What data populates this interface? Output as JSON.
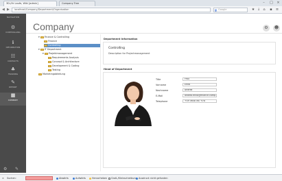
{
  "browser": {
    "tab1_title": "3D-/Hr Laufe, Wiki [admin]",
    "tab2_title": "Company Tree",
    "url": "localhost/Company/Department/Organisation",
    "search_placeholder": "Google"
  },
  "leftnav": {
    "items": [
      {
        "label": "NAVIGATION",
        "icon": "compass-icon"
      },
      {
        "label": "CONTROLLING",
        "icon": "gear-icon"
      },
      {
        "label": "INFORMATION",
        "icon": "info-icon"
      },
      {
        "label": "CONTACTS",
        "icon": "contacts-icon"
      },
      {
        "label": "TRAINING",
        "icon": "training-icon"
      },
      {
        "label": "REPORT",
        "icon": "report-icon"
      },
      {
        "label": "COMPANY",
        "icon": "company-icon"
      }
    ]
  },
  "app": {
    "title": "Company"
  },
  "tree": {
    "items": [
      {
        "label": "Finance & Controlling"
      },
      {
        "label": "Finance"
      },
      {
        "label": "Controlling"
      },
      {
        "label": "IT Department"
      },
      {
        "label": "Projektmanagement"
      },
      {
        "label": "Requirements Analysis"
      },
      {
        "label": "Concept & Architecture"
      },
      {
        "label": "Development & Coding"
      },
      {
        "label": "Testing"
      },
      {
        "label": "Marketingabteilung"
      }
    ]
  },
  "department": {
    "section_label": "Department Information",
    "name": "Controlling",
    "description": "Description for Projectmanagement"
  },
  "head": {
    "section_label": "Head of Department",
    "fields": [
      {
        "label": "Title",
        "value": "Frau"
      },
      {
        "label": "Vorname",
        "value": "Erika"
      },
      {
        "label": "Nachname",
        "value": "Andrea"
      },
      {
        "label": "E-Mail",
        "value": "andrea.erika@finance-comp.de"
      },
      {
        "label": "Telephone",
        "value": "+49 0648 067 978"
      }
    ]
  },
  "statusbar": {
    "find_label": "Suchen:",
    "prev": "Abwärts",
    "next": "Aufwärts",
    "highlight": "Hervorheben",
    "case": "Groß-/Kleinschreibung",
    "result": "Ausdruck nicht gefunden"
  }
}
